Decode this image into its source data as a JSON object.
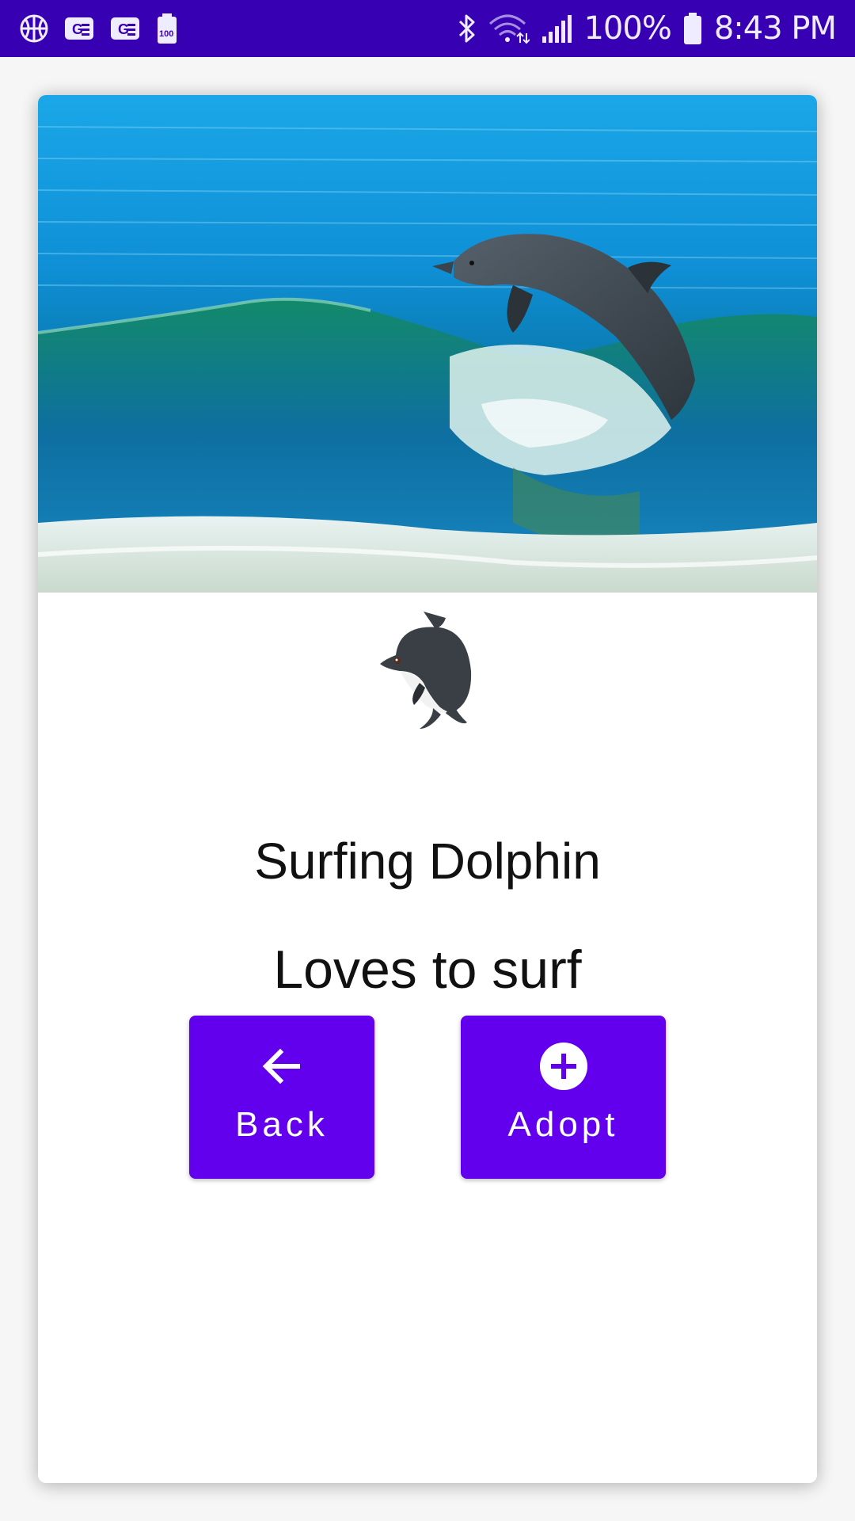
{
  "status_bar": {
    "battery_percent": "100%",
    "time": "8:43 PM",
    "left_icons": [
      "basketball-icon",
      "news-icon",
      "news-icon",
      "battery-100-icon"
    ],
    "right_icons": [
      "bluetooth-icon",
      "wifi-icon",
      "signal-icon",
      "battery-icon"
    ],
    "background_color": "#3700b3"
  },
  "pet": {
    "image": "dolphin-photo",
    "emoji": "dolphin-emoji-icon",
    "name": "Surfing Dolphin",
    "description": "Loves to surf"
  },
  "actions": {
    "back_label": "Back",
    "back_icon": "arrow-left-icon",
    "adopt_label": "Adopt",
    "adopt_icon": "add-circle-icon",
    "button_color": "#6200ee"
  }
}
